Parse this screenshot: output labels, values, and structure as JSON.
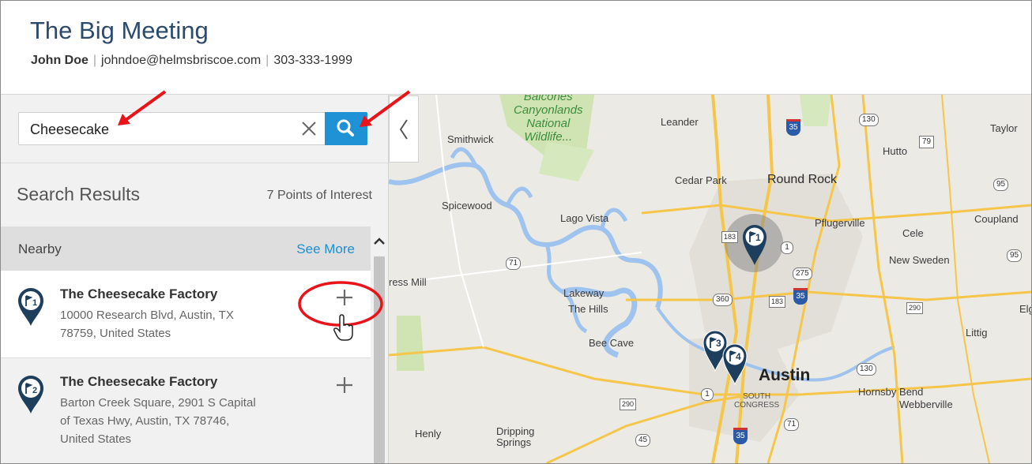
{
  "header": {
    "title": "The Big Meeting",
    "name": "John Doe",
    "email": "johndoe@helmsbriscoe.com",
    "phone": "303-333-1999"
  },
  "search": {
    "value": "Cheesecake"
  },
  "results": {
    "title": "Search Results",
    "count": "7 Points of Interest",
    "section_label": "Nearby",
    "see_more": "See More",
    "items": [
      {
        "number": "1",
        "name": "The Cheesecake Factory",
        "address_line1": "10000 Research Blvd, Austin, TX",
        "address_line2": "78759, United States"
      },
      {
        "number": "2",
        "name": "The Cheesecake Factory",
        "address_line1": "Barton Creek Square, 2901 S Capital",
        "address_line2": "of Texas Hwy, Austin, TX 78746,",
        "address_line3": "United States"
      }
    ]
  },
  "map": {
    "labels": {
      "park": "Balcones\nCanyonlands\nNational\nWildlife...",
      "leander": "Leander",
      "taylor": "Taylor",
      "hutto": "Hutto",
      "smithwick": "Smithwick",
      "cedar_park": "Cedar Park",
      "round_rock": "Round Rock",
      "spicewood": "Spicewood",
      "lago_vista": "Lago Vista",
      "pflugerville": "Pflugerville",
      "coupland": "Coupland",
      "cele": "Cele",
      "new_sweden": "New Sweden",
      "press_mill": "ress Mill",
      "lakeway": "Lakeway",
      "the_hills": "The Hills",
      "elgin": "Elgin",
      "littig": "Littig",
      "bee_cave": "Bee Cave",
      "austin": "Austin",
      "south_congress": "SOUTH\nCONGRESS",
      "hornsby_bend": "Hornsby Bend",
      "webberville": "Webberville",
      "henly": "Henly",
      "dripping_springs": "Dripping\nSprings"
    },
    "shields": {
      "i35_top": "35",
      "r130_top": "130",
      "r79": "79",
      "r95_a": "95",
      "r95_b": "95",
      "r183": "183",
      "r1_a": "1",
      "r275": "275",
      "i35_mid": "35",
      "r71": "71",
      "r360": "360",
      "r183b": "183",
      "r290_a": "290",
      "r130_b": "130",
      "r1_b": "1",
      "r290_b": "290",
      "r45": "45",
      "r71_b": "71",
      "i35_bot": "35"
    },
    "pins": [
      "1",
      "3",
      "4"
    ]
  },
  "colors": {
    "brand": "#2c4a6b",
    "accent": "#1f92d6",
    "pin": "#1d3e5c"
  },
  "icons": {
    "clear": "close-icon",
    "search": "search-icon",
    "collapse": "chevron-left-icon",
    "scroll": "chevron-up-icon",
    "add": "plus-icon",
    "pin": "map-pin-flag-icon"
  }
}
